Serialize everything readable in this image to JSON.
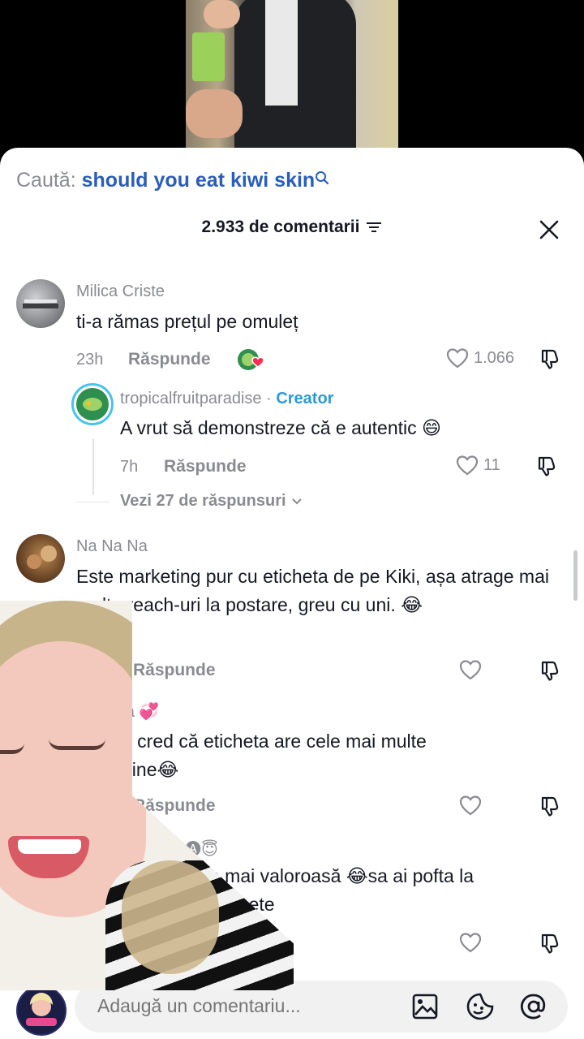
{
  "search": {
    "prefix": "Caută:",
    "query": "should you eat kiwi skin"
  },
  "header": {
    "count": "2.933 de comentarii"
  },
  "comments": [
    {
      "username": "Milica Criste",
      "text": "ti-a rămas prețul pe omuleț",
      "time": "23h",
      "reply_label": "Răspunde",
      "likes": "1.066"
    },
    {
      "username": "Na Na Na",
      "text": "Este marketing pur cu eticheta de pe Kiki, așa atrage mai multe reach-uri la postare, greu cu uni. 😂",
      "time": "",
      "reply_label": "Răspunde",
      "likes": ""
    },
    {
      "username": "bela 💞",
      "text": "u cred că eticheta are cele mai multe\nnine😂",
      "time": "",
      "reply_label": "Răspunde",
      "likes": ""
    },
    {
      "username": "🅐🅟🅘🅐😇",
      "text": "a mai valoroasă 😂sa ai pofta la\netichete",
      "time": "",
      "reply_label": "",
      "likes": ""
    }
  ],
  "reply": {
    "username": "tropicalfruitparadise",
    "separator": " · ",
    "badge": "Creator",
    "text": "A vrut să demonstreze că e autentic 😄",
    "time": "7h",
    "reply_label": "Răspunde",
    "likes": "11"
  },
  "view_replies": "Vezi 27 de răspunsuri",
  "input": {
    "placeholder": "Adaugă un comentariu..."
  },
  "colors": {
    "accent_blue": "#2b5db9",
    "creator_blue": "#2b9bd6",
    "muted": "#8a8b91",
    "text": "#161823"
  }
}
